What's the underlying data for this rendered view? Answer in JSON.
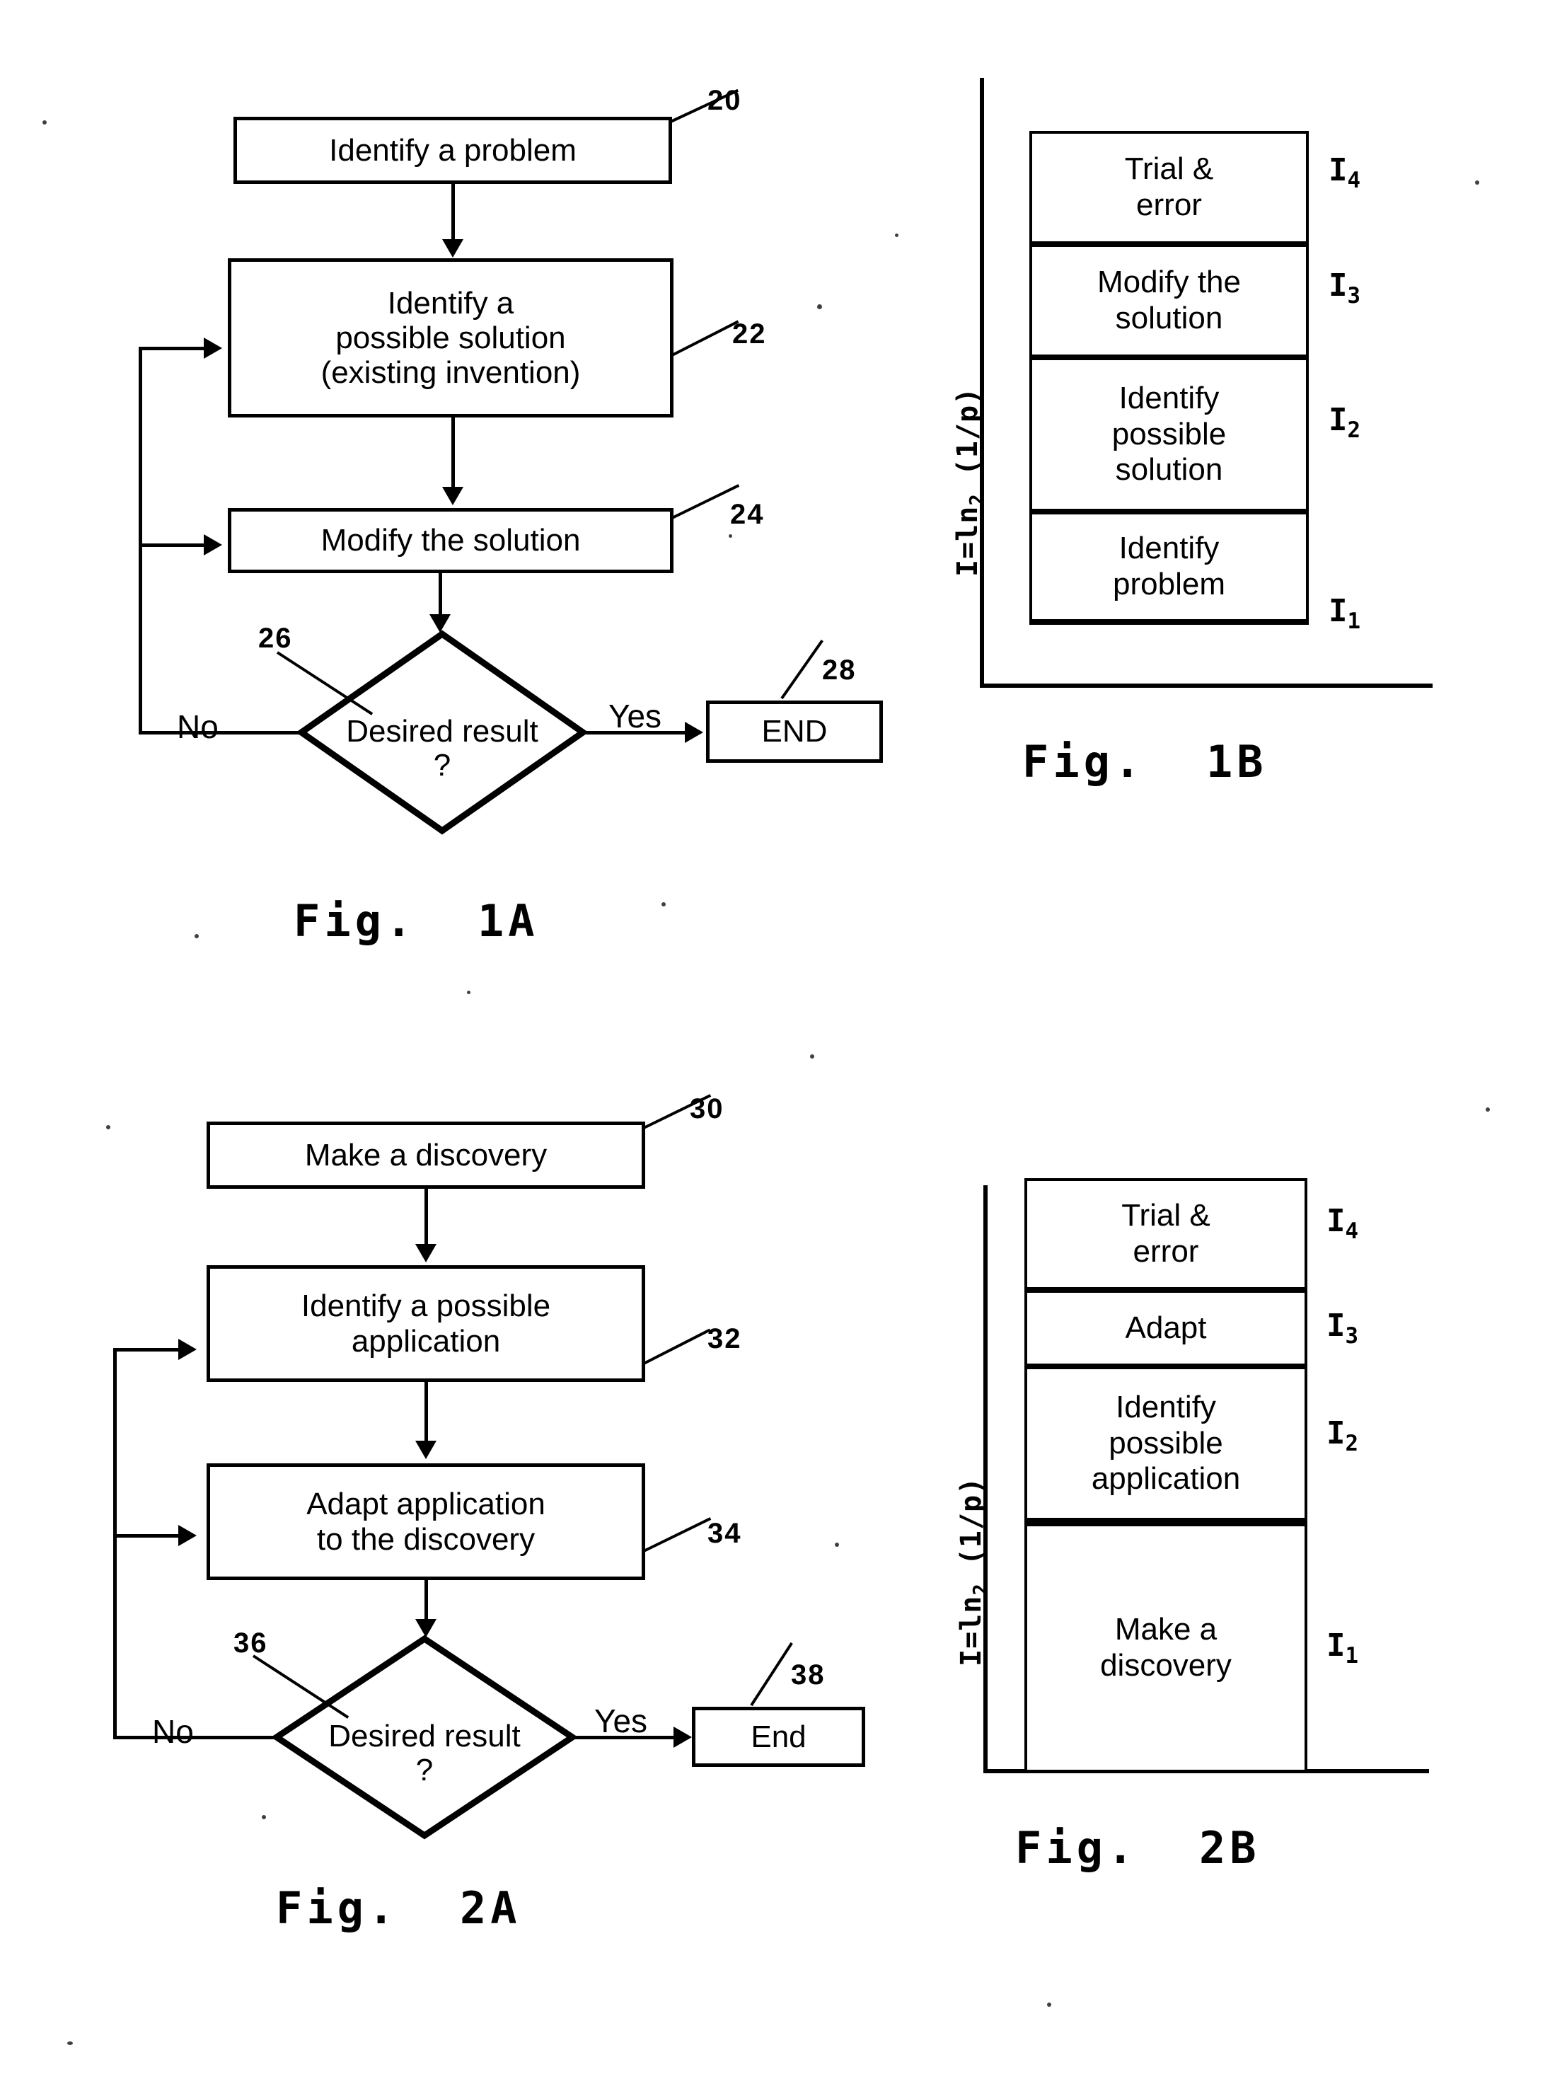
{
  "figures": [
    {
      "id": "fig1a",
      "caption": "Fig.  1A",
      "type": "flowchart",
      "nodes": [
        {
          "ref": "20",
          "label": "Identify a problem",
          "shape": "process"
        },
        {
          "ref": "22",
          "label": "Identify a\npossible solution\n(existing invention)",
          "shape": "process"
        },
        {
          "ref": "24",
          "label": "Modify the solution",
          "shape": "process"
        },
        {
          "ref": "26",
          "label": "Desired\nresult\n?",
          "shape": "decision"
        },
        {
          "ref": "28",
          "label": "END",
          "shape": "terminator"
        }
      ],
      "edge_labels": {
        "no": "No",
        "yes": "Yes"
      }
    },
    {
      "id": "fig1b",
      "caption": "Fig.  1B",
      "type": "stacked-bar",
      "axis_label": "I=ln2 (1/p)",
      "axis_label_parts": {
        "prefix": "I=ln",
        "base": "2",
        "suffix": " (1/p)"
      },
      "cells": [
        {
          "label": "Trial &\nerror",
          "i": "I",
          "sub": "4"
        },
        {
          "label": "Modify the\nsolution",
          "i": "I",
          "sub": "3"
        },
        {
          "label": "Identify\npossible\nsolution",
          "i": "I",
          "sub": "2"
        },
        {
          "label": "Identify\nproblem",
          "i": "I",
          "sub": "1"
        }
      ]
    },
    {
      "id": "fig2a",
      "caption": "Fig.  2A",
      "type": "flowchart",
      "nodes": [
        {
          "ref": "30",
          "label": "Make a discovery",
          "shape": "process"
        },
        {
          "ref": "32",
          "label": "Identify a possible\napplication",
          "shape": "process"
        },
        {
          "ref": "34",
          "label": "Adapt application\nto the discovery",
          "shape": "process"
        },
        {
          "ref": "36",
          "label": "Desired\nresult\n?",
          "shape": "decision"
        },
        {
          "ref": "38",
          "label": "End",
          "shape": "terminator"
        }
      ],
      "edge_labels": {
        "no": "No",
        "yes": "Yes"
      }
    },
    {
      "id": "fig2b",
      "caption": "Fig.  2B",
      "type": "stacked-bar",
      "axis_label": "I=ln2 (1/p)",
      "axis_label_parts": {
        "prefix": "I=ln",
        "base": "2",
        "suffix": " (1/p)"
      },
      "cells": [
        {
          "label": "Trial &\nerror",
          "i": "I",
          "sub": "4"
        },
        {
          "label": "Adapt",
          "i": "I",
          "sub": "3"
        },
        {
          "label": "Identify\npossible\napplication",
          "i": "I",
          "sub": "2"
        },
        {
          "label": "Make a\ndiscovery",
          "i": "I",
          "sub": "1"
        }
      ]
    }
  ],
  "fig1a": {
    "n20": "Identify a problem",
    "n22_l1": "Identify a",
    "n22_l2": "possible solution",
    "n22_l3": "(existing invention)",
    "n24": "Modify the solution",
    "n26_l1": "Desired",
    "n26_l2": "result",
    "n26_l3": "?",
    "n28": "END",
    "no": "No",
    "yes": "Yes",
    "r20": "20",
    "r22": "22",
    "r24": "24",
    "r26": "26",
    "r28": "28",
    "caption": "Fig.  1A"
  },
  "fig1b": {
    "c1_l1": "Trial &",
    "c1_l2": "error",
    "c2_l1": "Modify the",
    "c2_l2": "solution",
    "c3_l1": "Identify",
    "c3_l2": "possible",
    "c3_l3": "solution",
    "c4_l1": "Identify",
    "c4_l2": "problem",
    "i4": "I",
    "i4s": "4",
    "i3": "I",
    "i3s": "3",
    "i2": "I",
    "i2s": "2",
    "i1": "I",
    "i1s": "1",
    "ax_prefix": "I=ln",
    "ax_base": "2",
    "ax_suffix": " (1/p)",
    "caption": "Fig.  1B"
  },
  "fig2a": {
    "n30": "Make a discovery",
    "n32_l1": "Identify a possible",
    "n32_l2": "application",
    "n34_l1": "Adapt application",
    "n34_l2": "to the discovery",
    "n36_l1": "Desired",
    "n36_l2": "result",
    "n36_l3": "?",
    "n38": "End",
    "no": "No",
    "yes": "Yes",
    "r30": "30",
    "r32": "32",
    "r34": "34",
    "r36": "36",
    "r38": "38",
    "caption": "Fig.  2A"
  },
  "fig2b": {
    "c1_l1": "Trial &",
    "c1_l2": "error",
    "c2_l1": "Adapt",
    "c3_l1": "Identify",
    "c3_l2": "possible",
    "c3_l3": "application",
    "c4_l1": "Make a",
    "c4_l2": "discovery",
    "i4": "I",
    "i4s": "4",
    "i3": "I",
    "i3s": "3",
    "i2": "I",
    "i2s": "2",
    "i1": "I",
    "i1s": "1",
    "ax_prefix": "I=ln",
    "ax_base": "2",
    "ax_suffix": " (1/p)",
    "caption": "Fig.  2B"
  }
}
